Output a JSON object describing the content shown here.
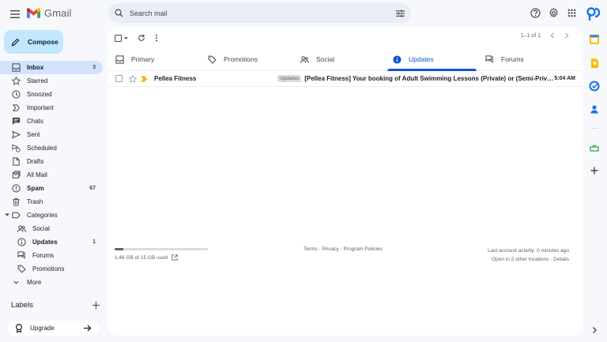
{
  "app": {
    "logo_text": "Gmail"
  },
  "search": {
    "placeholder": "Search mail"
  },
  "compose": {
    "label": "Compose"
  },
  "nav": [
    {
      "label": "Inbox",
      "count": "3",
      "icon": "inbox-icon",
      "active": true
    },
    {
      "label": "Starred",
      "count": "",
      "icon": "star-icon"
    },
    {
      "label": "Snoozed",
      "count": "",
      "icon": "clock-icon"
    },
    {
      "label": "Important",
      "count": "",
      "icon": "important-icon"
    },
    {
      "label": "Chats",
      "count": "",
      "icon": "chat-icon"
    },
    {
      "label": "Sent",
      "count": "",
      "icon": "send-icon"
    },
    {
      "label": "Scheduled",
      "count": "",
      "icon": "scheduled-icon"
    },
    {
      "label": "Drafts",
      "count": "",
      "icon": "draft-icon"
    },
    {
      "label": "All Mail",
      "count": "",
      "icon": "all-mail-icon"
    },
    {
      "label": "Spam",
      "count": "67",
      "icon": "spam-icon",
      "bold": true
    },
    {
      "label": "Trash",
      "count": "",
      "icon": "trash-icon"
    },
    {
      "label": "Categories",
      "count": "",
      "icon": "label-icon"
    },
    {
      "label": "Social",
      "count": "",
      "icon": "social-icon",
      "sub": true
    },
    {
      "label": "Updates",
      "count": "1",
      "icon": "info-icon",
      "sub": true,
      "bold": true
    },
    {
      "label": "Forums",
      "count": "",
      "icon": "forum-icon",
      "sub": true
    },
    {
      "label": "Promotions",
      "count": "",
      "icon": "tag-icon",
      "sub": true
    },
    {
      "label": "More",
      "count": "",
      "icon": "chevron-down-icon"
    }
  ],
  "labels": {
    "title": "Labels"
  },
  "upgrade": {
    "label": "Upgrade"
  },
  "pager": {
    "text": "1–1 of 1"
  },
  "tabs": [
    {
      "label": "Primary",
      "icon": "inbox-icon"
    },
    {
      "label": "Promotions",
      "icon": "tag-icon"
    },
    {
      "label": "Social",
      "icon": "social-icon"
    },
    {
      "label": "Updates",
      "icon": "info-icon",
      "active": true
    },
    {
      "label": "Forums",
      "icon": "forum-icon"
    }
  ],
  "email": {
    "sender": "Pellea Fitness",
    "label": "Updates",
    "subject": "[Pellea Fitness] Your booking of Adult Swimming Lessons (Private) or (Semi-Private) in Toro...",
    "time": "5:04 AM"
  },
  "footer": {
    "storage": "1.46 GB of 15 GB used",
    "storage_fraction": 0.097,
    "policies": "Terms · Privacy · Program Policies",
    "activity": "Last account activity: 0 minutes ago",
    "locations": "Open in 2 other locations · Details"
  },
  "colors": {
    "accent": "#0b57d0",
    "compose_bg": "#c2e7ff",
    "active_nav": "#d3e3fd",
    "important_marker": "#f2b600"
  }
}
